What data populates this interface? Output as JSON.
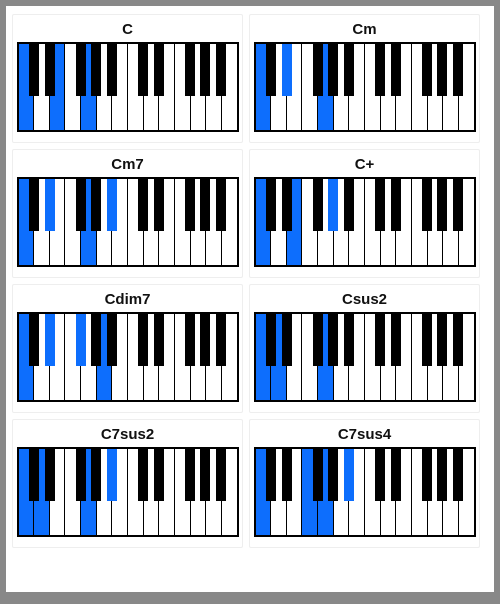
{
  "colors": {
    "highlight": "#0d6efd"
  },
  "piano": {
    "white_per_octave": 7,
    "octaves": 2,
    "black_in_octave": [
      {
        "after_white": 0,
        "semitone": 1
      },
      {
        "after_white": 1,
        "semitone": 3
      },
      {
        "after_white": 3,
        "semitone": 6
      },
      {
        "after_white": 4,
        "semitone": 8
      },
      {
        "after_white": 5,
        "semitone": 10
      }
    ],
    "white_semitones": [
      0,
      2,
      4,
      5,
      7,
      9,
      11
    ]
  },
  "chords": [
    {
      "name": "C",
      "notes": [
        0,
        4,
        7
      ]
    },
    {
      "name": "Cm",
      "notes": [
        0,
        3,
        7
      ]
    },
    {
      "name": "Cm7",
      "notes": [
        0,
        3,
        7,
        10
      ]
    },
    {
      "name": "C+",
      "notes": [
        0,
        4,
        8
      ]
    },
    {
      "name": "Cdim7",
      "notes": [
        0,
        3,
        6,
        9
      ]
    },
    {
      "name": "Csus2",
      "notes": [
        0,
        2,
        7
      ]
    },
    {
      "name": "C7sus2",
      "notes": [
        0,
        2,
        7,
        10
      ]
    },
    {
      "name": "C7sus4",
      "notes": [
        0,
        5,
        7,
        10
      ]
    }
  ]
}
